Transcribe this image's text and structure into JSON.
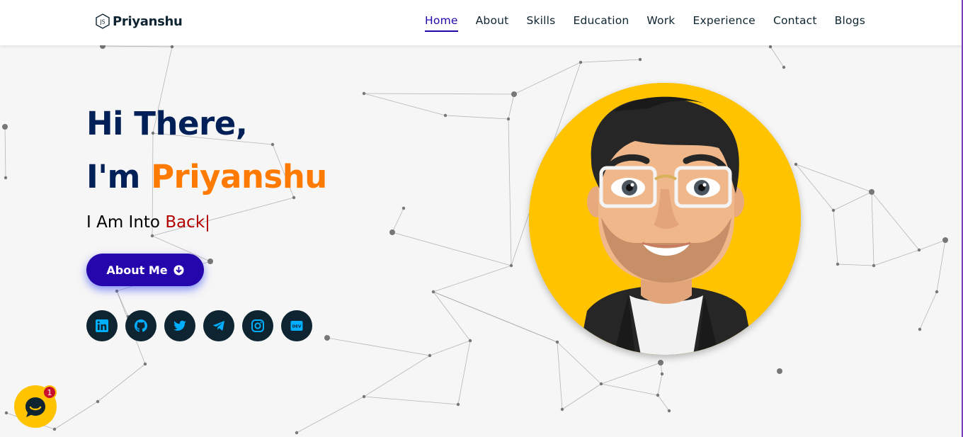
{
  "header": {
    "brand_icon": "nodejs-icon",
    "brand_name": "Priyanshu",
    "nav": [
      {
        "label": "Home",
        "active": true
      },
      {
        "label": "About",
        "active": false
      },
      {
        "label": "Skills",
        "active": false
      },
      {
        "label": "Education",
        "active": false
      },
      {
        "label": "Work",
        "active": false
      },
      {
        "label": "Experience",
        "active": false
      },
      {
        "label": "Contact",
        "active": false
      },
      {
        "label": "Blogs",
        "active": false
      }
    ]
  },
  "hero": {
    "greeting": "Hi There,",
    "intro": "I'm ",
    "name": "Priyanshu",
    "typed_prefix": "I Am Into ",
    "typed_word": "Back",
    "cursor": "|",
    "about_button": "About Me",
    "about_icon": "arrow-circle-down-icon"
  },
  "socials": [
    {
      "name": "linkedin-icon"
    },
    {
      "name": "github-icon"
    },
    {
      "name": "twitter-icon"
    },
    {
      "name": "telegram-icon"
    },
    {
      "name": "instagram-icon"
    },
    {
      "name": "dev-icon"
    }
  ],
  "chat": {
    "badge_count": "1",
    "icon": "chat-bubble-icon"
  },
  "colors": {
    "navy": "#002057",
    "accent_orange": "#ff7a00",
    "typed_red": "#b30000",
    "button_blue": "#2506ad",
    "social_bg": "#0e2431",
    "social_icon": "#00aeff",
    "avatar_bg": "#ffc300"
  }
}
